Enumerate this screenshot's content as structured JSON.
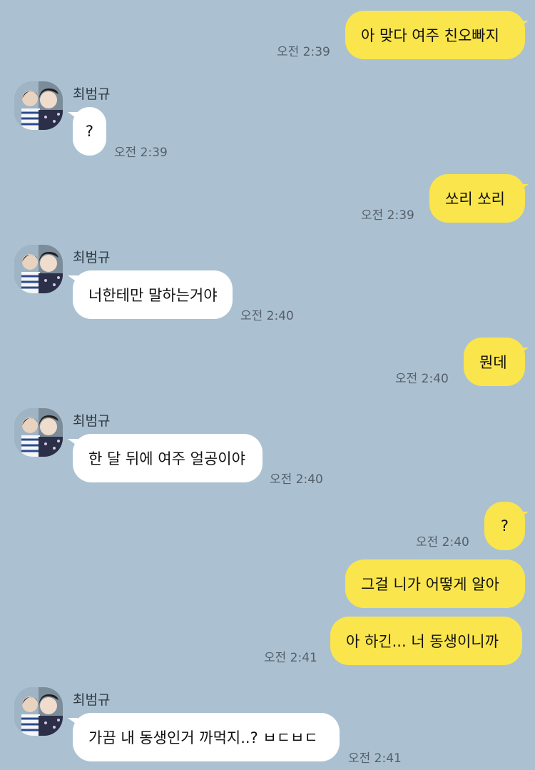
{
  "sender": {
    "name": "최범규"
  },
  "colors": {
    "background": "#abc1d1",
    "my_bubble": "#fae54c",
    "their_bubble": "#ffffff"
  },
  "messages": [
    {
      "from": "me",
      "text": "아 맞다 여주 친오빠지",
      "time": "오전 2:39"
    },
    {
      "from": "them",
      "text": "?",
      "time": "오전 2:39"
    },
    {
      "from": "me",
      "text": "쏘리 쏘리",
      "time": "오전 2:39"
    },
    {
      "from": "them",
      "text": "너한테만 말하는거야",
      "time": "오전 2:40"
    },
    {
      "from": "me",
      "text": "뭔데",
      "time": "오전 2:40"
    },
    {
      "from": "them",
      "text": "한 달 뒤에 여주 얼공이야",
      "time": "오전 2:40"
    },
    {
      "from": "me",
      "text": "?",
      "time": "오전 2:40"
    },
    {
      "from": "me",
      "text": "그걸 니가 어떻게 알아",
      "time": ""
    },
    {
      "from": "me",
      "text": "아 하긴... 너 동생이니까",
      "time": "오전 2:41"
    },
    {
      "from": "them",
      "text": "가끔 내 동생인거 까먹지..? ㅂㄷㅂㄷ",
      "time": "오전 2:41"
    }
  ]
}
